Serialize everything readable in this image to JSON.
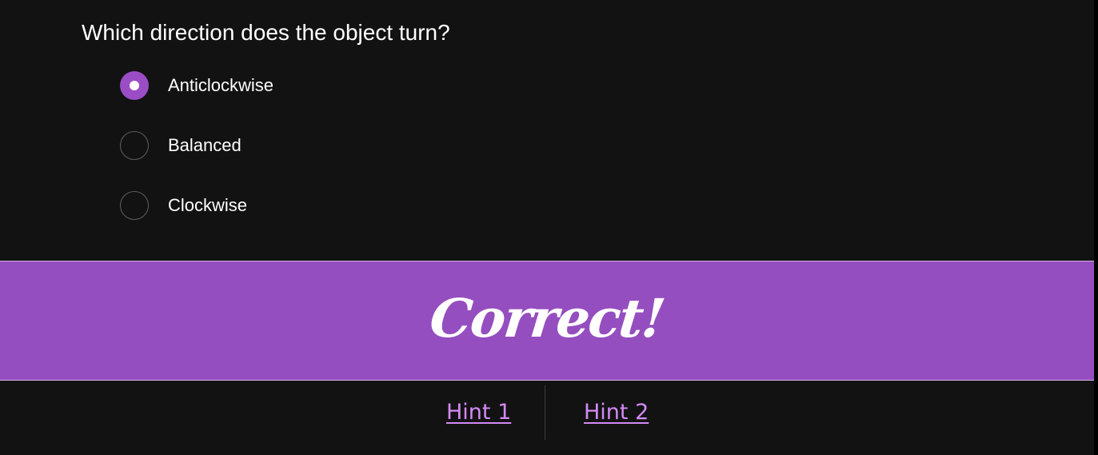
{
  "question": {
    "text": "Which direction does the object turn?"
  },
  "options": [
    {
      "label": "Anticlockwise",
      "selected": true
    },
    {
      "label": "Balanced",
      "selected": false
    },
    {
      "label": "Clockwise",
      "selected": false
    }
  ],
  "feedback": {
    "text": "Correct!",
    "color": "#954ebf"
  },
  "hints": [
    {
      "label": "Hint 1"
    },
    {
      "label": "Hint 2"
    }
  ],
  "colors": {
    "background": "#121212",
    "accent": "#9b4dc6",
    "link": "#d48af6"
  }
}
